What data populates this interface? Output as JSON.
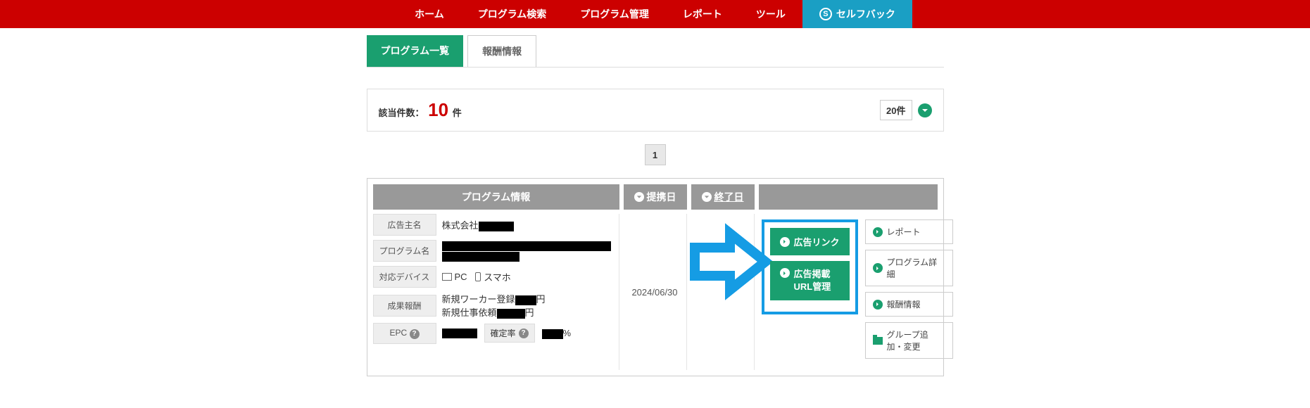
{
  "nav": {
    "home": "ホーム",
    "search": "プログラム検索",
    "manage": "プログラム管理",
    "report": "レポート",
    "tool": "ツール",
    "selfback": "セルフバック"
  },
  "tabs": {
    "list": "プログラム一覧",
    "reward": "報酬情報"
  },
  "count": {
    "label": "該当件数：",
    "value": "10",
    "suffix": "件",
    "per_page": "20件"
  },
  "pager": {
    "page": "1"
  },
  "headers": {
    "info": "プログラム情報",
    "date": "提携日",
    "end": "終了日"
  },
  "info_labels": {
    "advertiser": "広告主名",
    "program": "プログラム名",
    "device": "対応デバイス",
    "reward": "成果報酬",
    "epc": "EPC",
    "rate": "確定率"
  },
  "program": {
    "advertiser_prefix": "株式会社",
    "device_pc": "PC",
    "device_sp": "スマホ",
    "reward_line1_a": "新規ワーカー登録",
    "reward_line1_b": "円",
    "reward_line2_a": "新規仕事依頼",
    "reward_line2_b": "円",
    "rate_pct": "%",
    "partner_date": "2024/06/30"
  },
  "actions": {
    "ad_link": "広告リンク",
    "url_manage": "広告掲載\nURL管理",
    "url_manage_l1": "広告掲載",
    "url_manage_l2": "URL管理",
    "report": "レポート",
    "detail": "プログラム詳細",
    "reward_info": "報酬情報",
    "group": "グループ追加・変更"
  }
}
